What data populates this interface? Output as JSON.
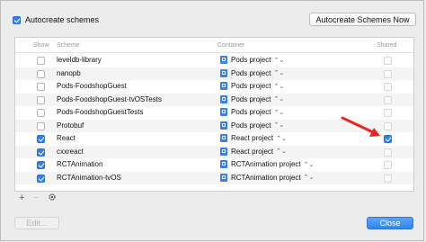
{
  "autocreate": {
    "label": "Autocreate schemes",
    "checked": true
  },
  "autocreate_now_label": "Autocreate Schemes Now",
  "columns": {
    "show": "Show",
    "scheme": "Scheme",
    "container": "Container",
    "shared": "Shared"
  },
  "rows": [
    {
      "name": "leveldb-library",
      "container": "Pods project",
      "show": false,
      "shared": false
    },
    {
      "name": "nanopb",
      "container": "Pods project",
      "show": false,
      "shared": false
    },
    {
      "name": "Pods-FoodshopGuest",
      "container": "Pods project",
      "show": false,
      "shared": false
    },
    {
      "name": "Pods-FoodshopGuest-tvOSTests",
      "container": "Pods project",
      "show": false,
      "shared": false
    },
    {
      "name": "Pods-FoodshopGuestTests",
      "container": "Pods project",
      "show": false,
      "shared": false
    },
    {
      "name": "Protobuf",
      "container": "Pods project",
      "show": false,
      "shared": false
    },
    {
      "name": "React",
      "container": "React project",
      "show": true,
      "shared": true
    },
    {
      "name": "cxxreact",
      "container": "React project",
      "show": true,
      "shared": false
    },
    {
      "name": "RCTAnimation",
      "container": "RCTAnimation project",
      "show": true,
      "shared": false
    },
    {
      "name": "RCTAnimation-tvOS",
      "container": "RCTAnimation project",
      "show": true,
      "shared": false
    }
  ],
  "chevron_glyph": "⌃⌄",
  "toolbar": {
    "add": "+",
    "remove": "−",
    "settings_icon": "gear-icon"
  },
  "edit_label": "Edit...",
  "close_label": "Close",
  "colors": {
    "accent": "#2f80f0",
    "annotation_arrow": "#e8261f"
  }
}
